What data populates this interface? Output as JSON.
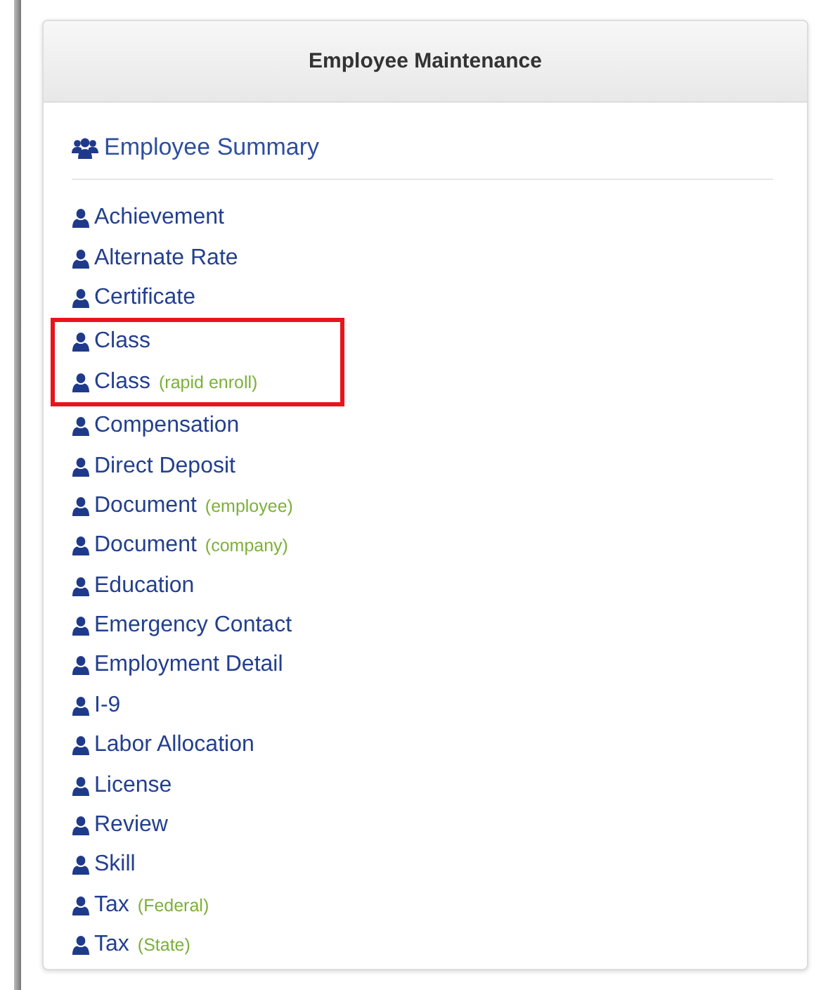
{
  "panel": {
    "title": "Employee Maintenance"
  },
  "summary_link": {
    "label": "Employee Summary"
  },
  "items": [
    {
      "label": "Achievement",
      "highlighted": false
    },
    {
      "label": "Alternate Rate",
      "highlighted": false
    },
    {
      "label": "Certificate",
      "highlighted": false
    },
    {
      "label": "Class",
      "highlighted": true
    },
    {
      "label": "Class",
      "note": "(rapid enroll)",
      "highlighted": true
    },
    {
      "label": "Compensation",
      "highlighted": false
    },
    {
      "label": "Direct Deposit",
      "highlighted": false
    },
    {
      "label": "Document",
      "note": "(employee)",
      "highlighted": false
    },
    {
      "label": "Document",
      "note": "(company)",
      "highlighted": false
    },
    {
      "label": "Education",
      "highlighted": false
    },
    {
      "label": "Emergency Contact",
      "highlighted": false
    },
    {
      "label": "Employment Detail",
      "highlighted": false
    },
    {
      "label": "I-9",
      "highlighted": false
    },
    {
      "label": "Labor Allocation",
      "highlighted": false
    },
    {
      "label": "License",
      "highlighted": false
    },
    {
      "label": "Review",
      "highlighted": false
    },
    {
      "label": "Skill",
      "highlighted": false
    },
    {
      "label": "Tax",
      "note": "(Federal)",
      "highlighted": false
    },
    {
      "label": "Tax",
      "note": "(State)",
      "highlighted": false
    }
  ]
}
